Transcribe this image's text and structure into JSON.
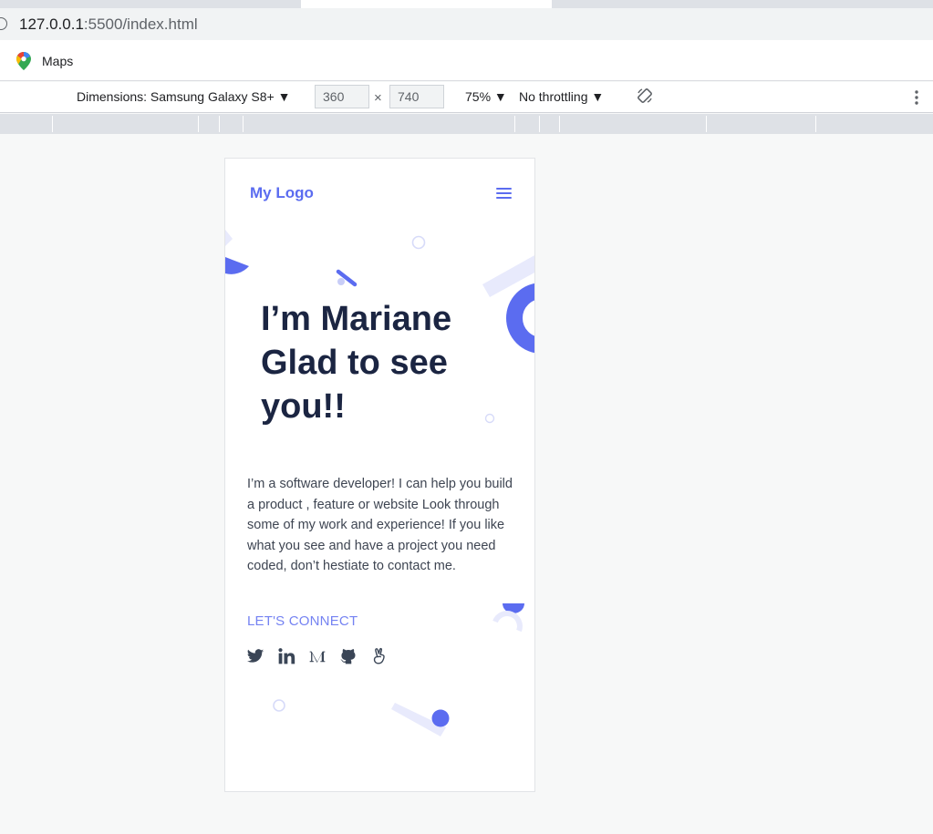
{
  "browser": {
    "url_host": "127.0.0.1",
    "url_rest": ":5500/index.html",
    "bookmark_label": "Maps"
  },
  "devtools": {
    "dimensions_label": "Dimensions: Samsung Galaxy S8+ ▼",
    "width_value": "360",
    "height_value": "740",
    "times": "×",
    "zoom": "75% ▼",
    "throttling": "No throttling ▼"
  },
  "site": {
    "logo": "My Logo",
    "hero_line1": "I’m Mariane",
    "hero_line2": "Glad to see",
    "hero_line3": "you!!",
    "bio": "I’m a software developer! I can help you build a product , feature or website Look through some of my work and experience! If you like what you see and have a project you need coded, don’t hestiate to contact me.",
    "connect_label": "LET'S CONNECT",
    "social_icons": [
      "twitter-icon",
      "linkedin-icon",
      "medium-icon",
      "github-icon",
      "angellist-icon"
    ]
  },
  "colors": {
    "accent": "#5b6cf0",
    "accent_light": "#e8eafc",
    "heading": "#1b2542",
    "body_text": "#3e4552",
    "social_icon": "#3a4556"
  }
}
